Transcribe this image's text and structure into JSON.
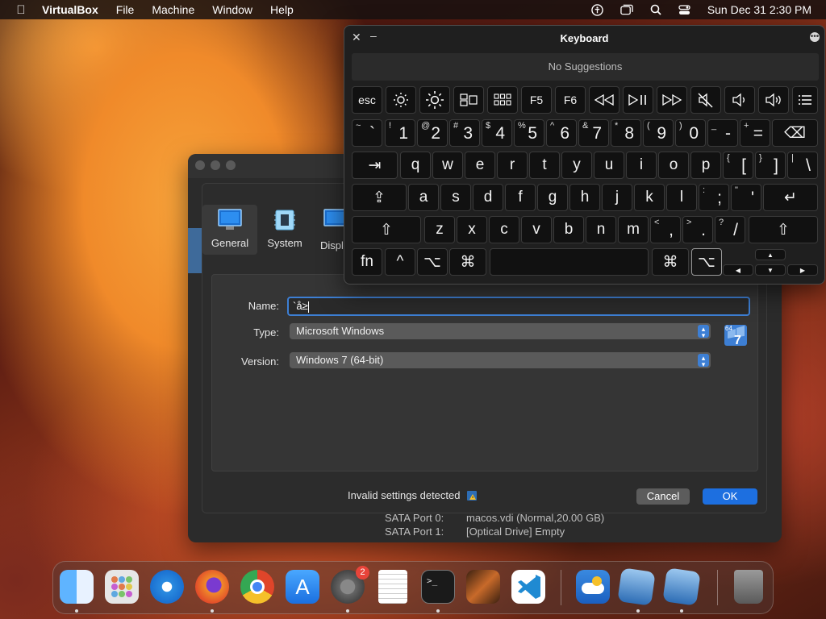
{
  "menubar": {
    "app": "VirtualBox",
    "items": [
      "File",
      "Machine",
      "Window",
      "Help"
    ],
    "datetime": "Sun Dec 31  2:30 PM"
  },
  "vm_window": {
    "storage": [
      {
        "port": "SATA Port 0:",
        "value": "macos.vdi (Normal,20.00 GB)"
      },
      {
        "port": "SATA Port 1:",
        "value": "[Optical Drive] Empty"
      }
    ]
  },
  "settings_dialog": {
    "tabs": [
      "General",
      "System",
      "Displ"
    ],
    "fields": {
      "name_label": "Name:",
      "name_value": "`å≥",
      "type_label": "Type:",
      "type_value": "Microsoft Windows",
      "version_label": "Version:",
      "version_value": "Windows 7 (64-bit)"
    },
    "os_badge": "64",
    "os_badge_num": "7",
    "invalid_text": "Invalid settings detected",
    "cancel_label": "Cancel",
    "ok_label": "OK"
  },
  "keyboard_viewer": {
    "title": "Keyboard",
    "suggestions": "No Suggestions",
    "row_fn": [
      "esc",
      "☀",
      "☀",
      "▭▭",
      "⊞",
      "F5",
      "F6",
      "⏪",
      "⏯",
      "⏩",
      "🔇",
      "🔈",
      "🔊",
      "☰"
    ],
    "row_num": [
      {
        "up": "~",
        "lo": "`"
      },
      {
        "up": "!",
        "lo": "1"
      },
      {
        "up": "@",
        "lo": "2"
      },
      {
        "up": "#",
        "lo": "3"
      },
      {
        "up": "$",
        "lo": "4"
      },
      {
        "up": "%",
        "lo": "5"
      },
      {
        "up": "^",
        "lo": "6"
      },
      {
        "up": "&",
        "lo": "7"
      },
      {
        "up": "*",
        "lo": "8"
      },
      {
        "up": "(",
        "lo": "9"
      },
      {
        "up": ")",
        "lo": "0"
      },
      {
        "up": "_",
        "lo": "-"
      },
      {
        "up": "+",
        "lo": "="
      }
    ],
    "delete": "⌫",
    "tab": "⇥",
    "row_q": [
      "q",
      "w",
      "e",
      "r",
      "t",
      "y",
      "u",
      "i",
      "o",
      "p"
    ],
    "row_q_sym": [
      {
        "up": "{",
        "lo": "["
      },
      {
        "up": "}",
        "lo": "]"
      },
      {
        "up": "|",
        "lo": "\\"
      }
    ],
    "caps": "⇪",
    "row_a": [
      "a",
      "s",
      "d",
      "f",
      "g",
      "h",
      "j",
      "k",
      "l"
    ],
    "row_a_sym": [
      {
        "up": ":",
        "lo": ";"
      },
      {
        "up": "\"",
        "lo": "'"
      }
    ],
    "return": "↵",
    "shift": "⇧",
    "row_z": [
      "z",
      "x",
      "c",
      "v",
      "b",
      "n",
      "m"
    ],
    "row_z_sym": [
      {
        "up": "<",
        "lo": ","
      },
      {
        "up": ">",
        "lo": "."
      },
      {
        "up": "?",
        "lo": "/"
      }
    ],
    "bottom": {
      "fn": "fn",
      "ctrl": "^",
      "opt": "⌥",
      "cmd": "⌘"
    },
    "arrows": {
      "up": "▲",
      "left": "◀",
      "down": "▼",
      "right": "▶"
    }
  },
  "dock": {
    "notification_badge": "2",
    "apps": [
      "Finder",
      "Launchpad",
      "Safari",
      "Firefox",
      "Chrome",
      "App Store",
      "System Settings",
      "TextEdit",
      "Terminal",
      "GarageBand",
      "VS Code",
      "Weather",
      "VirtualBox",
      "VirtualBox VM",
      "Trash"
    ]
  }
}
